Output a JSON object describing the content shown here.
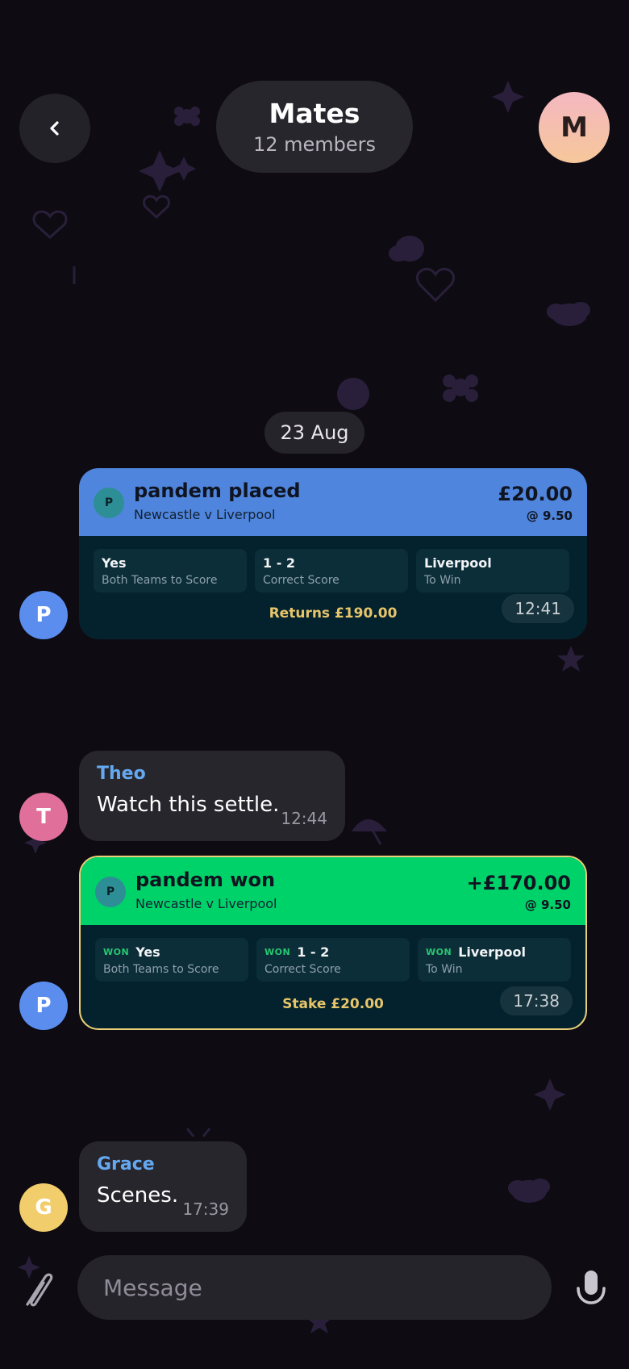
{
  "header": {
    "title": "Mates",
    "subtitle": "12 members",
    "profile_initial": "M"
  },
  "date_separator": "23 Aug",
  "messages": [
    {
      "type": "bet",
      "avatar": "P",
      "head_title": "pandem placed",
      "match": "Newcastle v Liverpool",
      "amount": "£20.00",
      "odds": "@ 9.50",
      "head_color": "#4f85dc",
      "legs": [
        {
          "pick": "Yes",
          "market": "Both Teams to Score"
        },
        {
          "pick": "1 - 2",
          "market": "Correct Score"
        },
        {
          "pick": "Liverpool",
          "market": "To Win"
        }
      ],
      "footer": "Returns £190.00",
      "time": "12:41"
    },
    {
      "type": "text",
      "avatar": "T",
      "sender": "Theo",
      "text": "Watch this settle.",
      "time": "12:44"
    },
    {
      "type": "bet",
      "avatar": "P",
      "head_title": "pandem won",
      "match": "Newcastle v Liverpool",
      "amount": "+£170.00",
      "odds": "@ 9.50",
      "head_color": "#00d26a",
      "legs": [
        {
          "status": "WON",
          "pick": "Yes",
          "market": "Both Teams to Score"
        },
        {
          "status": "WON",
          "pick": "1 - 2",
          "market": "Correct Score"
        },
        {
          "status": "WON",
          "pick": "Liverpool",
          "market": "To Win"
        }
      ],
      "footer": "Stake £20.00",
      "time": "17:38"
    },
    {
      "type": "text",
      "avatar": "G",
      "sender": "Grace",
      "text": "Scenes.",
      "time": "17:39"
    }
  ],
  "composer": {
    "placeholder": "Message",
    "attach_icon": "paperclip-icon",
    "mic_icon": "microphone-icon"
  },
  "colors": {
    "background": "#0e0b12",
    "avatar_p": "#5b8def",
    "avatar_t": "#e0709a",
    "avatar_g": "#f1cd6b",
    "sender_name": "#64a9f0",
    "bet_placed": "#4f85dc",
    "bet_won": "#00d26a"
  }
}
